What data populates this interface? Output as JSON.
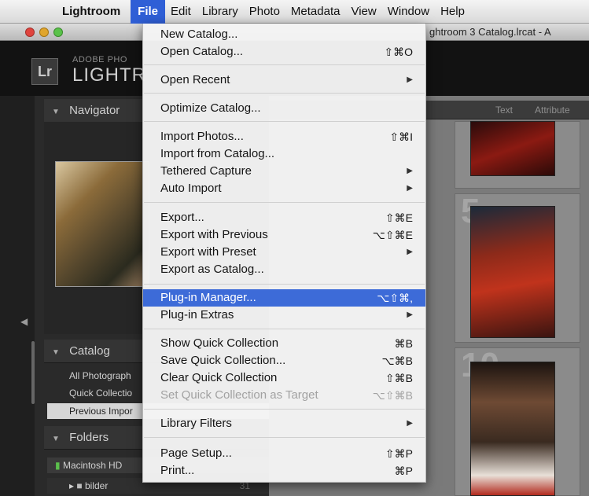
{
  "menubar": {
    "apple": "",
    "items": [
      "Lightroom",
      "File",
      "Edit",
      "Library",
      "Photo",
      "Metadata",
      "View",
      "Window",
      "Help"
    ],
    "active_item": "File"
  },
  "window": {
    "title": "ghtroom 3 Catalog.lrcat - A"
  },
  "lr_header": {
    "logo": "Lr",
    "small": "ADOBE PHO",
    "big": "LIGHTR"
  },
  "left_panel": {
    "navigator_label": "Navigator",
    "catalog_label": "Catalog",
    "catalog_items": [
      "All Photograph",
      "Quick Collectio",
      "Previous Impor"
    ],
    "folders_label": "Folders",
    "folder_volume": "Macintosh HD",
    "folder_item": "bilder",
    "folder_count": "31"
  },
  "filter_bar": {
    "text": "Text",
    "attribute": "Attribute"
  },
  "grid_numbers": [
    "5",
    "10"
  ],
  "file_menu": {
    "items": {
      "new_catalog": {
        "label": "New Catalog...",
        "shortcut": ""
      },
      "open_catalog": {
        "label": "Open Catalog...",
        "shortcut": "⇧⌘O"
      },
      "open_recent": {
        "label": "Open Recent",
        "shortcut": ""
      },
      "optimize_catalog": {
        "label": "Optimize Catalog...",
        "shortcut": ""
      },
      "import_photos": {
        "label": "Import Photos...",
        "shortcut": "⇧⌘I"
      },
      "import_from_catalog": {
        "label": "Import from Catalog...",
        "shortcut": ""
      },
      "tethered_capture": {
        "label": "Tethered Capture",
        "shortcut": ""
      },
      "auto_import": {
        "label": "Auto Import",
        "shortcut": ""
      },
      "export": {
        "label": "Export...",
        "shortcut": "⇧⌘E"
      },
      "export_with_previous": {
        "label": "Export with Previous",
        "shortcut": "⌥⇧⌘E"
      },
      "export_with_preset": {
        "label": "Export with Preset",
        "shortcut": ""
      },
      "export_as_catalog": {
        "label": "Export as Catalog...",
        "shortcut": ""
      },
      "plugin_manager": {
        "label": "Plug-in Manager...",
        "shortcut": "⌥⇧⌘,"
      },
      "plugin_extras": {
        "label": "Plug-in Extras",
        "shortcut": ""
      },
      "show_quick_collection": {
        "label": "Show Quick Collection",
        "shortcut": "⌘B"
      },
      "save_quick_collection": {
        "label": "Save Quick Collection...",
        "shortcut": "⌥⌘B"
      },
      "clear_quick_collection": {
        "label": "Clear Quick Collection",
        "shortcut": "⇧⌘B"
      },
      "set_quick_collection_target": {
        "label": "Set Quick Collection as Target",
        "shortcut": "⌥⇧⌘B"
      },
      "library_filters": {
        "label": "Library Filters",
        "shortcut": ""
      },
      "page_setup": {
        "label": "Page Setup...",
        "shortcut": "⇧⌘P"
      },
      "print": {
        "label": "Print...",
        "shortcut": "⌘P"
      }
    },
    "submenu_arrow": "▶"
  },
  "colors": {
    "highlight": "#3d6bd8",
    "menubar_active": "#2f5fd6",
    "lr_bg": "#121212"
  }
}
